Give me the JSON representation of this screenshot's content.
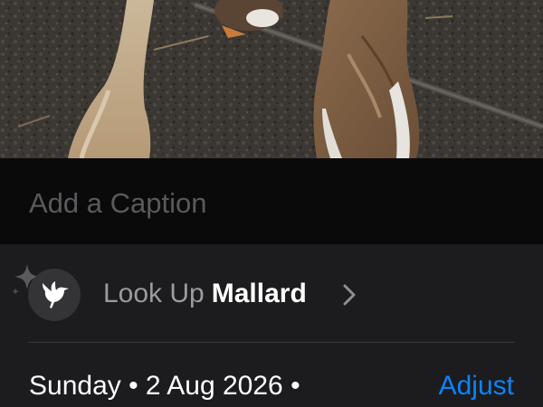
{
  "photo": {
    "subject": "ducks-photo"
  },
  "caption": {
    "placeholder": "Add a Caption"
  },
  "lookup": {
    "prefix": "Look Up",
    "name": "Mallard",
    "icon": "bird-icon",
    "accent_icon": "sparkle-icon"
  },
  "info": {
    "date": "Sunday • 2 Aug 2026 •",
    "adjust_label": "Adjust"
  },
  "colors": {
    "accent": "#0a84ff",
    "panel": "#1c1c1e",
    "caption_bg": "#0a0a0a"
  }
}
